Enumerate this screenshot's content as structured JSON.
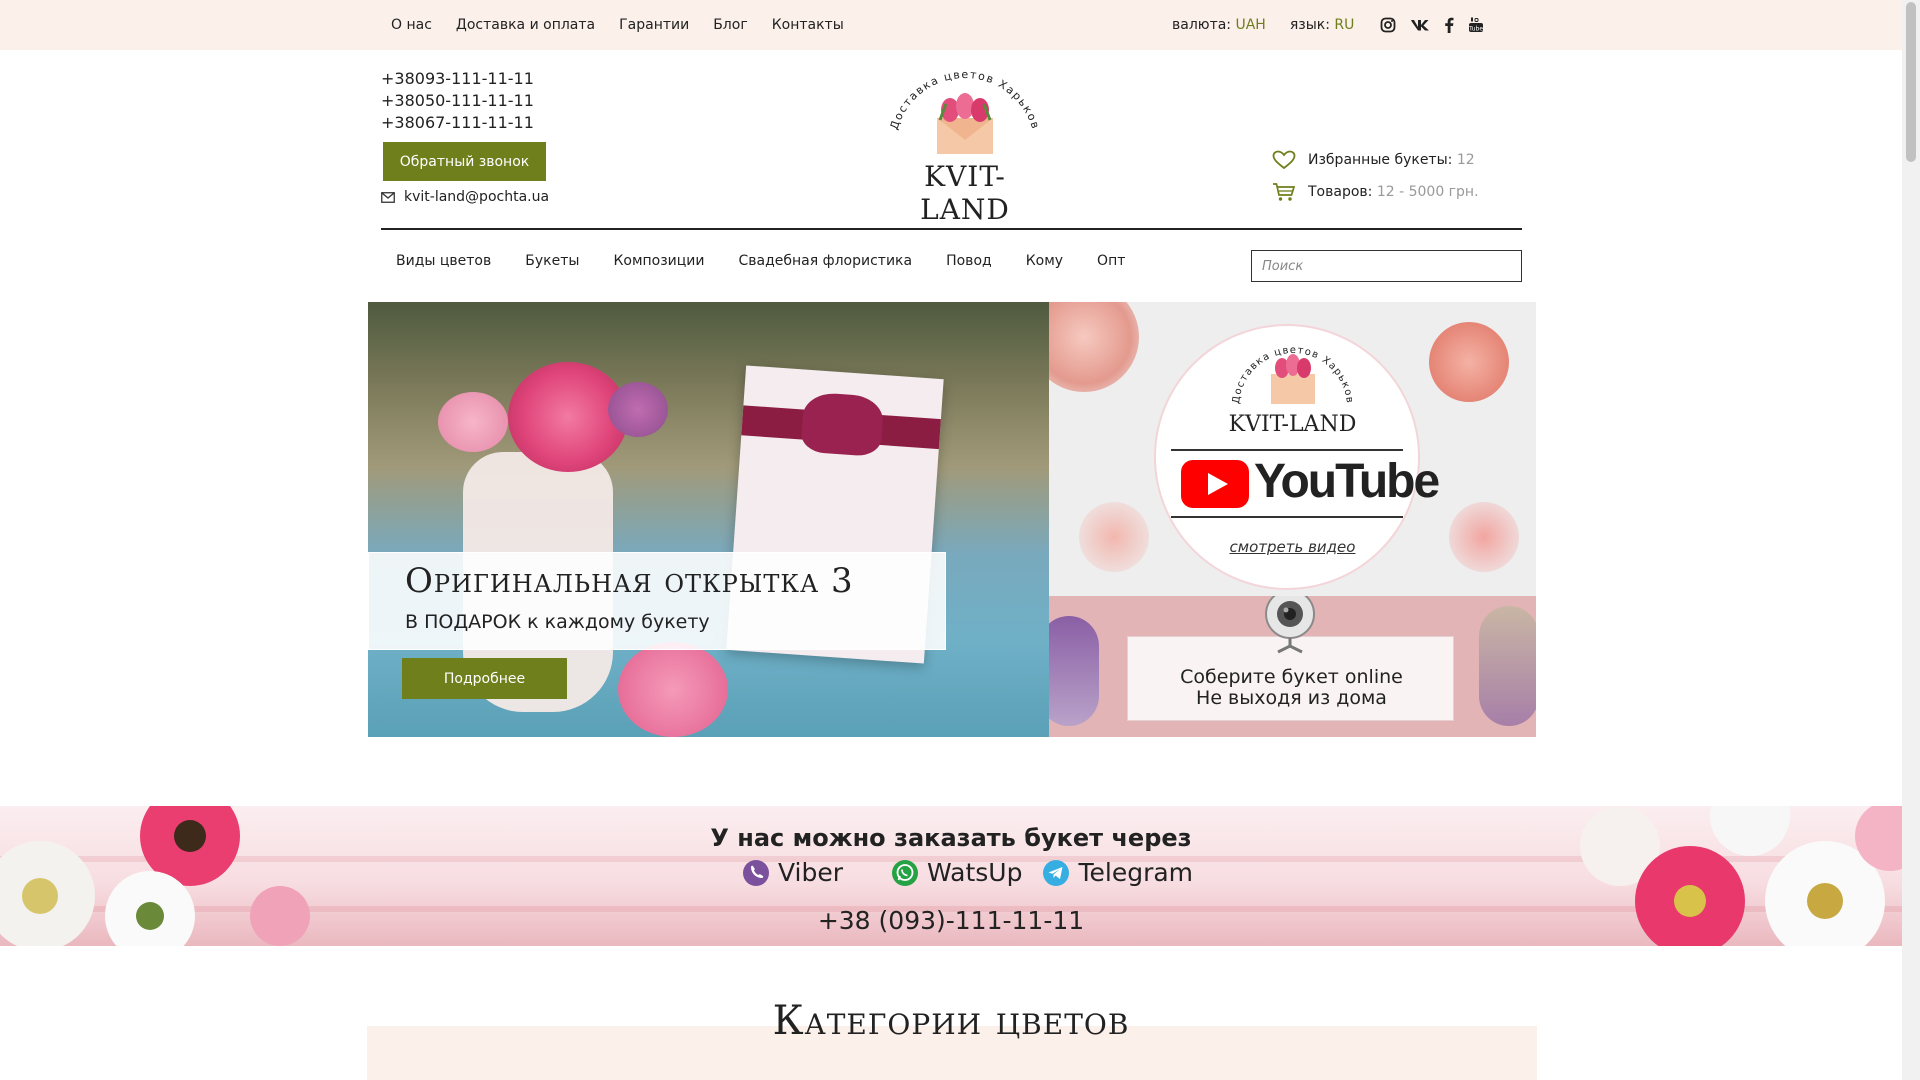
{
  "topbar": {
    "nav": [
      "О нас",
      "Доставка и оплата",
      "Гарантии",
      "Блог",
      "Контакты"
    ],
    "currency_label": "валюта:",
    "currency_value": "UAH",
    "language_label": "язык:",
    "language_value": "RU",
    "social_icons": [
      "instagram-icon",
      "vk-icon",
      "facebook-icon",
      "youtube-icon"
    ]
  },
  "header": {
    "phones": [
      "+38093-111-11-11",
      "+38050-111-11-11",
      "+38067-111-11-11"
    ],
    "callback_label": "Обратный звонок",
    "email": "kvit-land@pochta.ua",
    "logo": {
      "arc_text": "Доставка цветов Харьков",
      "brand": "KVIT-LAND"
    },
    "favorites_label": "Избранные букеты:",
    "favorites_count": "12",
    "cart_label": "Товаров:",
    "cart_value": "12 - 5000 грн."
  },
  "mainnav": {
    "items": [
      "Виды цветов",
      "Букеты",
      "Композиции",
      "Свадебная флористика",
      "Повод",
      "Кому",
      "Опт"
    ],
    "search_placeholder": "Поиск"
  },
  "banner": {
    "title": "Оригинальная открытка 3",
    "subtitle": "В ПОДАРОК к каждому букету",
    "button_label": "Подробнее"
  },
  "youtube_block": {
    "arc_text": "Доставка цветов Харьков",
    "brand": "KVIT-LAND",
    "logo_word": "YouTube",
    "watch_label": "смотреть видео"
  },
  "build_online": {
    "line1": "Соберите букет online",
    "line2": "Не выходя из дома"
  },
  "messengers": {
    "title": "У нас можно заказать букет через",
    "items": [
      {
        "label": "Viber",
        "icon": "viber-icon",
        "color": "#7b519d"
      },
      {
        "label": "WatsUp",
        "icon": "whatsapp-icon",
        "color": "#25a244"
      },
      {
        "label": "Telegram",
        "icon": "telegram-icon",
        "color": "#37aee2"
      }
    ],
    "phone": "+38 (093)-111-11-11"
  },
  "categories": {
    "title": "Категории цветов"
  },
  "colors": {
    "accent": "#6e7f1c",
    "accent_text": "#6f7f1e",
    "topbar_bg": "#fbf0ea"
  }
}
